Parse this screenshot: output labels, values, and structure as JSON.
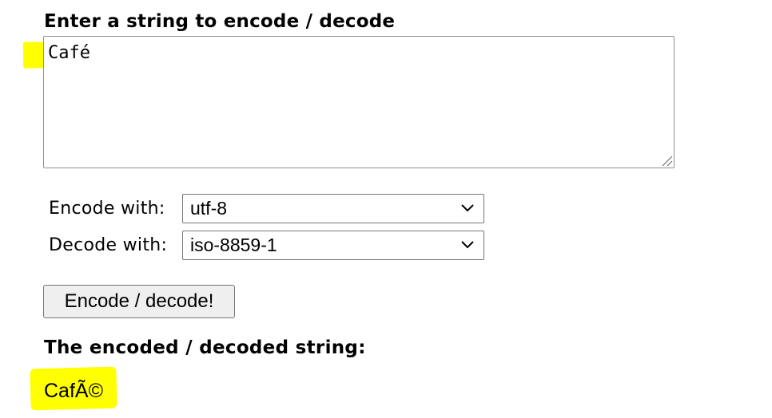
{
  "input_section": {
    "heading": "Enter a string to encode / decode",
    "textarea_value": "Café"
  },
  "options": {
    "encode_label": "Encode with:",
    "encode_value": "utf-8",
    "decode_label": "Decode with:",
    "decode_value": "iso-8859-1"
  },
  "action": {
    "button_label": "Encode / decode!"
  },
  "result_section": {
    "heading": "The encoded / decoded string:",
    "value": "CafÃ©"
  },
  "colors": {
    "highlight": "#ffff00",
    "button_bg": "#efefef",
    "border": "#767676"
  },
  "icons": {
    "select_arrow": "chevron-down-icon",
    "textarea_grip": "resize-grip-icon"
  }
}
